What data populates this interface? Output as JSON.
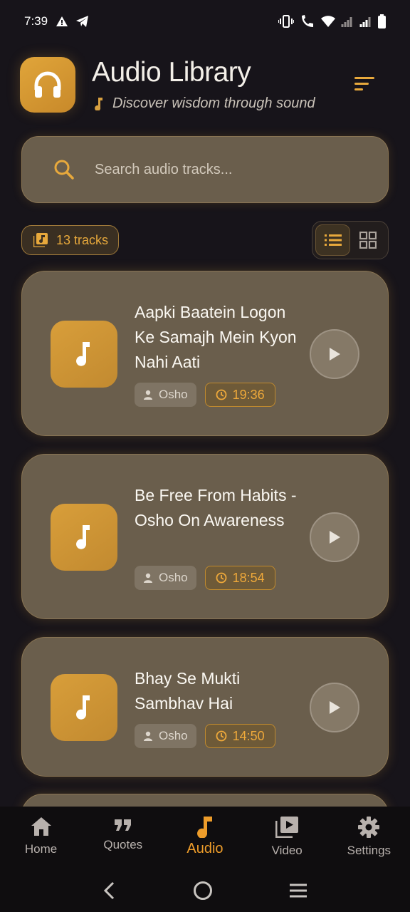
{
  "status": {
    "time": "7:39"
  },
  "header": {
    "title": "Audio Library",
    "subtitle": "Discover wisdom through sound"
  },
  "search": {
    "placeholder": "Search audio tracks..."
  },
  "tracks_badge": "13 tracks",
  "view_toggle": {
    "selected": "list"
  },
  "tracks": [
    {
      "title": "Aapki Baatein Logon Ke Samajh Mein Kyon Nahi Aati",
      "artist": "Osho",
      "duration": "19:36"
    },
    {
      "title": "Be Free From Habits - Osho On Awareness",
      "artist": "Osho",
      "duration": "18:54"
    },
    {
      "title": "Bhay Se Mukti Sambhav Hai",
      "artist": "Osho",
      "duration": "14:50"
    }
  ],
  "nav": {
    "items": [
      {
        "label": "Home",
        "icon": "home-icon"
      },
      {
        "label": "Quotes",
        "icon": "quote-icon"
      },
      {
        "label": "Audio",
        "icon": "music-note-icon",
        "active": true
      },
      {
        "label": "Video",
        "icon": "video-library-icon"
      },
      {
        "label": "Settings",
        "icon": "gear-icon"
      }
    ]
  },
  "colors": {
    "accent": "#E8A93C",
    "background": "#17141A",
    "card": "#6A5E4C"
  }
}
